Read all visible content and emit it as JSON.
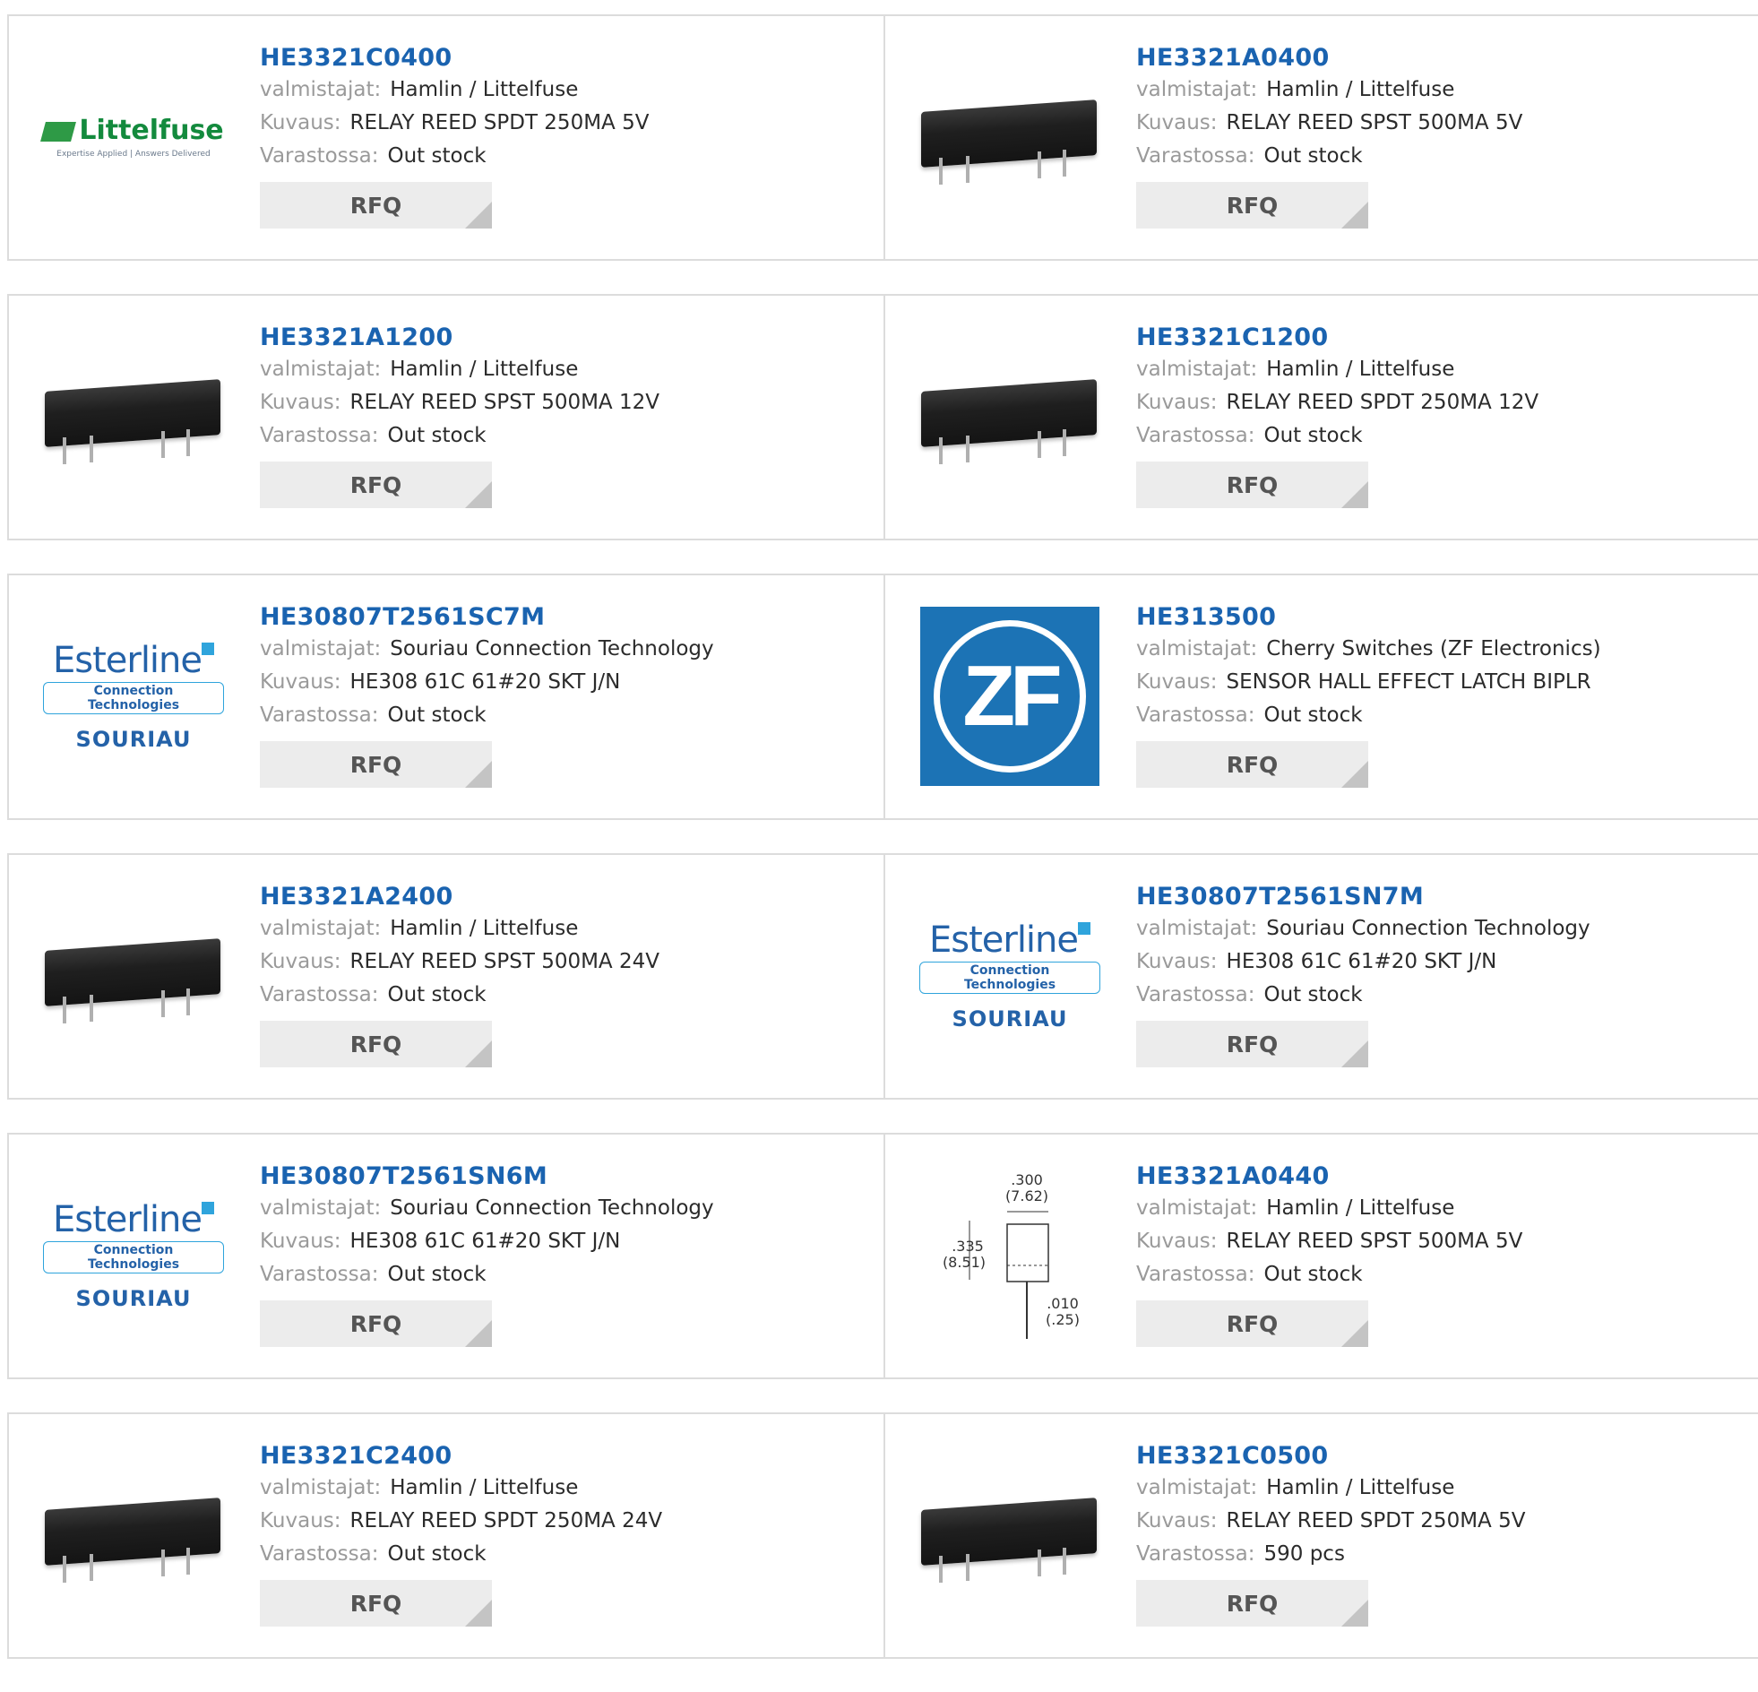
{
  "labels": {
    "manufacturer": "valmistajat:",
    "description": "Kuvaus:",
    "stock": "Varastossa:",
    "rfq": "RFQ"
  },
  "logos": {
    "littelfuse": {
      "name": "Littelfuse",
      "tagline": "Expertise Applied | Answers Delivered"
    },
    "esterline": {
      "name": "Esterline",
      "sub": "Connection Technologies",
      "brand": "SOURIAU"
    },
    "zf": {
      "text": "ZF"
    }
  },
  "products": [
    {
      "part": "HE3321C0400",
      "manufacturer": "Hamlin / Littelfuse",
      "description": "RELAY REED SPDT 250MA 5V",
      "stock": "Out stock",
      "image": "littelfuse-logo"
    },
    {
      "part": "HE3321A0400",
      "manufacturer": "Hamlin / Littelfuse",
      "description": "RELAY REED SPST 500MA 5V",
      "stock": "Out stock",
      "image": "relay-photo"
    },
    {
      "part": "HE3321A1200",
      "manufacturer": "Hamlin / Littelfuse",
      "description": "RELAY REED SPST 500MA 12V",
      "stock": "Out stock",
      "image": "relay-photo"
    },
    {
      "part": "HE3321C1200",
      "manufacturer": "Hamlin / Littelfuse",
      "description": "RELAY REED SPDT 250MA 12V",
      "stock": "Out stock",
      "image": "relay-photo"
    },
    {
      "part": "HE30807T2561SC7M",
      "manufacturer": "Souriau Connection Technology",
      "description": "HE308 61C 61#20 SKT J/N",
      "stock": "Out stock",
      "image": "esterline-logo"
    },
    {
      "part": "HE313500",
      "manufacturer": "Cherry Switches (ZF Electronics)",
      "description": "SENSOR HALL EFFECT LATCH BIPLR",
      "stock": "Out stock",
      "image": "zf-logo"
    },
    {
      "part": "HE3321A2400",
      "manufacturer": "Hamlin / Littelfuse",
      "description": "RELAY REED SPST 500MA 24V",
      "stock": "Out stock",
      "image": "relay-photo"
    },
    {
      "part": "HE30807T2561SN7M",
      "manufacturer": "Souriau Connection Technology",
      "description": "HE308 61C 61#20 SKT J/N",
      "stock": "Out stock",
      "image": "esterline-logo"
    },
    {
      "part": "HE30807T2561SN6M",
      "manufacturer": "Souriau Connection Technology",
      "description": "HE308 61C 61#20 SKT J/N",
      "stock": "Out stock",
      "image": "esterline-logo"
    },
    {
      "part": "HE3321A0440",
      "manufacturer": "Hamlin / Littelfuse",
      "description": "RELAY REED SPST 500MA 5V",
      "stock": "Out stock",
      "image": "dimension-drawing",
      "drawing": {
        "width_in": ".300",
        "width_mm": "(7.62)",
        "height_in": ".335",
        "height_mm": "(8.51)",
        "pin_in": ".010",
        "pin_mm": "(.25)"
      }
    },
    {
      "part": "HE3321C2400",
      "manufacturer": "Hamlin / Littelfuse",
      "description": "RELAY REED SPDT 250MA 24V",
      "stock": "Out stock",
      "image": "relay-photo"
    },
    {
      "part": "HE3321C0500",
      "manufacturer": "Hamlin / Littelfuse",
      "description": "RELAY REED SPDT 250MA 5V",
      "stock": "590 pcs",
      "image": "relay-photo"
    }
  ],
  "colors": {
    "part_link": "#1a63b0",
    "label": "#9a9a9a",
    "value": "#2b2b2b",
    "rfq_bg": "#ececec",
    "border": "#dcdcdc"
  }
}
